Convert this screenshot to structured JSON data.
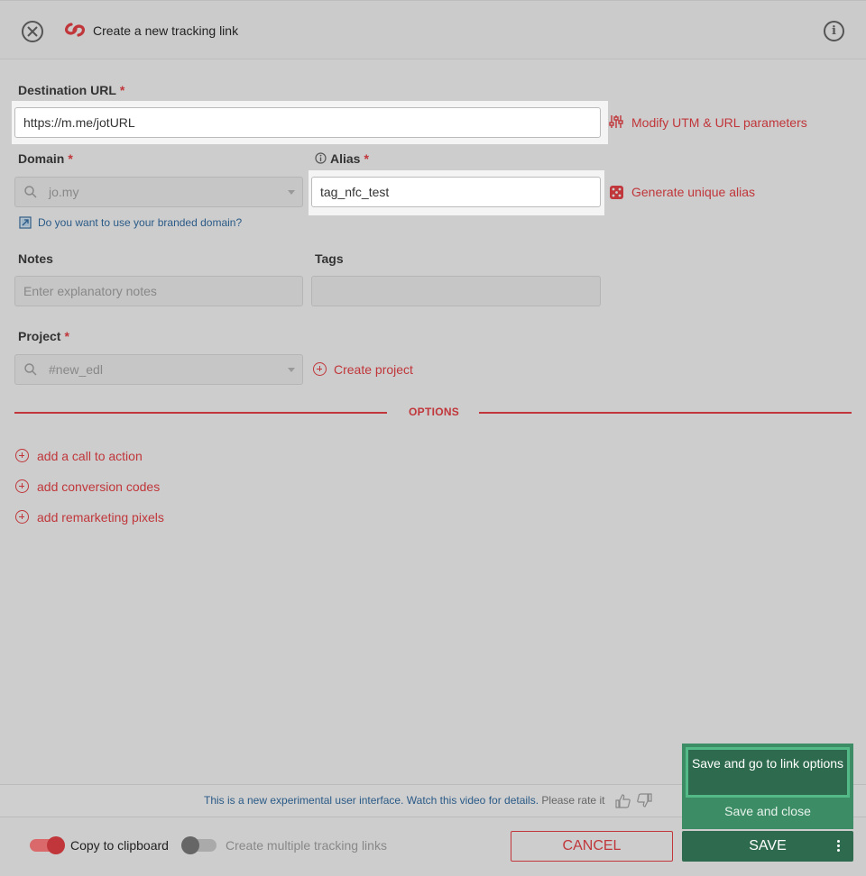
{
  "header": {
    "title": "Create a new tracking link"
  },
  "form": {
    "destination_label": "Destination URL",
    "destination_value": "https://m.me/jotURL",
    "utm_link": "Modify UTM & URL parameters",
    "domain_label": "Domain",
    "domain_value": "jo.my",
    "branded_link": "Do you want to use your branded domain?",
    "alias_label": "Alias",
    "alias_value": "tag_nfc_test",
    "generate_alias": "Generate unique alias",
    "notes_label": "Notes",
    "notes_placeholder": "Enter explanatory notes",
    "tags_label": "Tags",
    "project_label": "Project",
    "project_value": "#new_edl",
    "create_project": "Create project",
    "required_mark": "*"
  },
  "options": {
    "title": "OPTIONS",
    "items": [
      "add a call to action",
      "add conversion codes",
      "add remarketing pixels"
    ]
  },
  "notice": {
    "text": "This is a new experimental user interface. Watch this video for details.",
    "rate": "Please rate it"
  },
  "footer": {
    "copy_label": "Copy to clipboard",
    "copy_on": true,
    "multiple_label": "Create multiple tracking links",
    "multiple_on": false,
    "cancel": "CANCEL",
    "save": "SAVE"
  },
  "save_menu": {
    "go_options": "Save and go to link options",
    "save_close": "Save and close"
  },
  "colors": {
    "accent_red": "#c0363a",
    "save_green": "#2e6b4e",
    "link_blue": "#2a5a87"
  }
}
